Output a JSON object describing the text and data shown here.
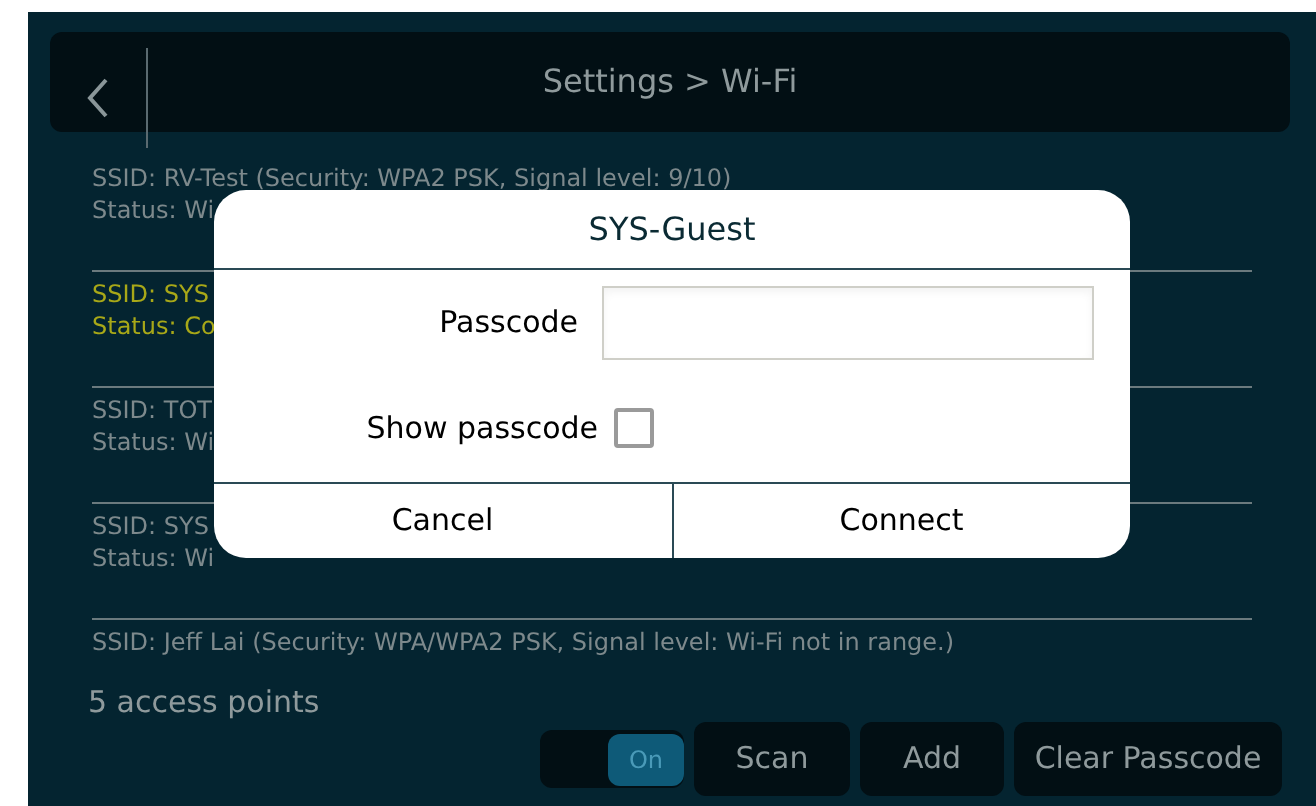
{
  "header": {
    "title": "Settings > Wi-Fi"
  },
  "access_points": [
    {
      "ssid": "SSID: RV-Test (Security: WPA2 PSK, Signal level: 9/10)",
      "status": "Status: Wi",
      "connected": false
    },
    {
      "ssid": "SSID: SYS",
      "status": "Status: Co",
      "connected": true
    },
    {
      "ssid": "SSID: TOT",
      "status": "Status: Wi",
      "connected": false
    },
    {
      "ssid": "SSID: SYS",
      "status": "Status: Wi",
      "connected": false
    },
    {
      "ssid": "SSID: Jeff Lai (Security: WPA/WPA2 PSK, Signal level: Wi-Fi not in range.)",
      "connected": false
    }
  ],
  "count": "5 access points",
  "wifi_toggle": {
    "label": "On",
    "on": true
  },
  "buttons": [
    "Scan",
    "Add",
    "Clear Passcode"
  ],
  "dialog": {
    "title": "SYS-Guest",
    "passcode_label": "Passcode",
    "show_passcode_label": "Show passcode",
    "show_passcode": false,
    "buttons": [
      "Cancel",
      "Connect"
    ]
  }
}
